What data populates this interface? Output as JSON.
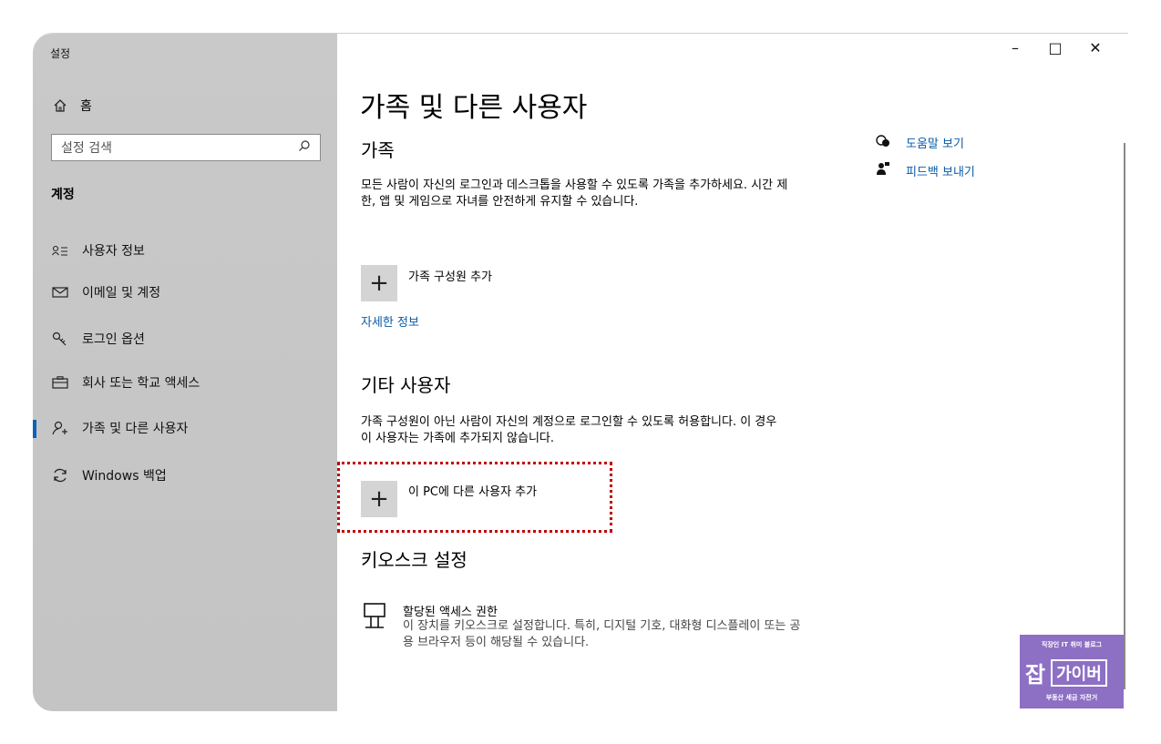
{
  "window": {
    "title": "설정",
    "controls": {
      "minimize": "–",
      "maximize": "□",
      "close": "✕"
    }
  },
  "sidebar": {
    "home": {
      "icon": "home-icon",
      "label": "홈"
    },
    "search_placeholder": "설정 검색",
    "section": "계정",
    "items": [
      {
        "icon": "user-info-icon",
        "label": "사용자 정보"
      },
      {
        "icon": "mail-icon",
        "label": "이메일 및 계정"
      },
      {
        "icon": "key-icon",
        "label": "로그인 옵션"
      },
      {
        "icon": "briefcase-icon",
        "label": "회사 또는 학교 액세스"
      },
      {
        "icon": "add-person-icon",
        "label": "가족 및 다른 사용자",
        "active": true
      },
      {
        "icon": "sync-icon",
        "label": "Windows 백업"
      }
    ]
  },
  "main": {
    "title": "가족 및 다른 사용자",
    "family": {
      "heading": "가족",
      "description": "모든 사람이 자신의 로그인과 데스크톱을 사용할 수 있도록 가족을 추가하세요. 시간 제한, 앱 및 게임으로 자녀를 안전하게 유지할 수 있습니다.",
      "add_label": "가족 구성원 추가",
      "more_info": "자세한 정보"
    },
    "other": {
      "heading": "기타 사용자",
      "description": "가족 구성원이 아닌 사람이 자신의 계정으로 로그인할 수 있도록 허용합니다. 이 경우 이 사용자는 가족에 추가되지 않습니다.",
      "add_label": "이 PC에 다른 사용자 추가"
    },
    "kiosk": {
      "heading": "키오스크 설정",
      "title": "할당된 액세스 권한",
      "description": "이 장치를 키오스크로 설정합니다. 특히, 디지털 기호, 대화형 디스플레이 또는 공용 브라우저 등이 해당될 수 있습니다."
    }
  },
  "help_links": [
    {
      "icon": "help-chat-icon",
      "label": "도움말 보기"
    },
    {
      "icon": "feedback-icon",
      "label": "피드백 보내기"
    }
  ],
  "watermark": {
    "top": "직장인 IT 취미 블로그",
    "big": "잡",
    "box": "가이버",
    "bottom": "부동산 세금 자전거"
  },
  "colors": {
    "accent": "#0a63b6",
    "link": "#0a5ba8",
    "highlight": "#c00000",
    "watermark": "#8d6fc4"
  }
}
